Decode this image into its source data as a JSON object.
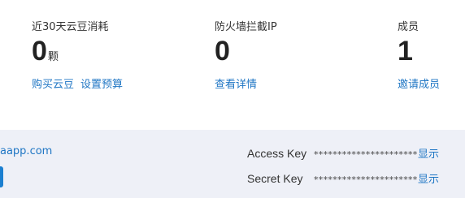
{
  "stats": {
    "yundou": {
      "label": "近30天云豆消耗",
      "value": "0",
      "unit": "颗",
      "links": [
        "购买云豆",
        "设置预算"
      ]
    },
    "firewall": {
      "label": "防火墙拦截IP",
      "value": "0",
      "link": "查看详情"
    },
    "members": {
      "label": "成员",
      "value": "1",
      "link": "邀请成员"
    }
  },
  "keys": {
    "domain_text": "aapp.com",
    "access": {
      "label": "Access Key",
      "mask": "**********************",
      "action": "显示"
    },
    "secret": {
      "label": "Secret Key",
      "mask": "**********************",
      "action": "显示"
    }
  },
  "colors": {
    "link": "#1f76c4",
    "panel_bg": "#eef0f7",
    "button": "#1b7fd0"
  }
}
